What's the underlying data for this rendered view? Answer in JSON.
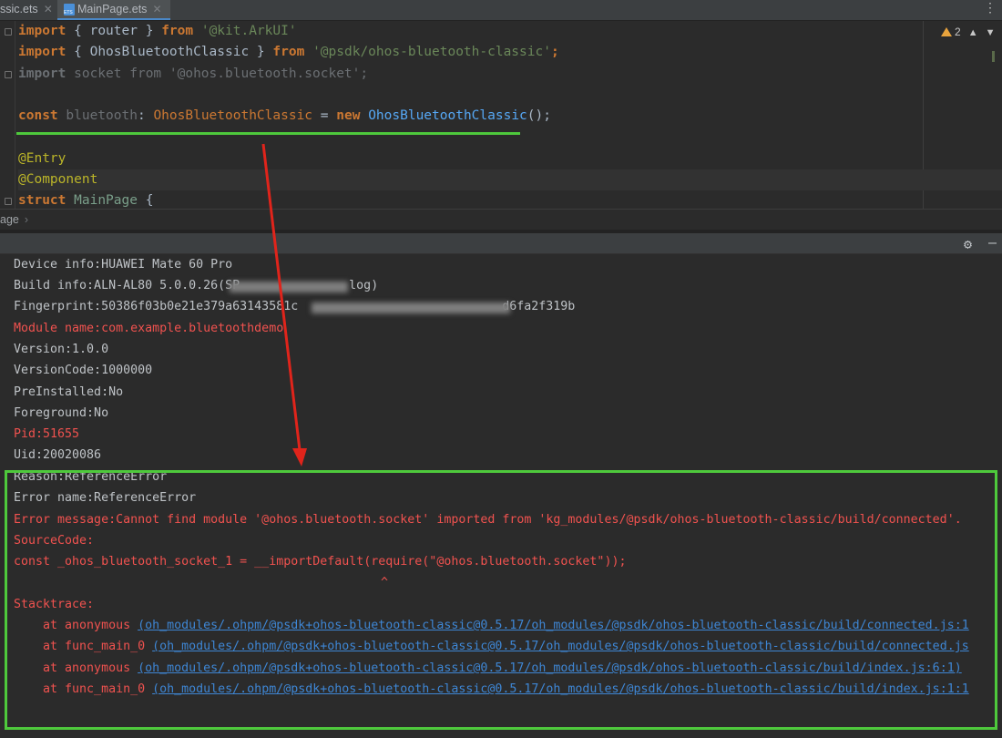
{
  "tabs": [
    {
      "label": "ssic.ets",
      "close": "✕"
    },
    {
      "label": "MainPage.ets",
      "close": "✕"
    }
  ],
  "tab_menu": "⋮",
  "editor": {
    "warning_count": "2",
    "lines": {
      "l1": {
        "kw1": "import",
        "p1": " { ",
        "id": "router",
        "p2": " } ",
        "kw2": "from",
        "sp": " ",
        "str": "'@kit.ArkUI'"
      },
      "l2": {
        "kw1": "import",
        "p1": " { ",
        "id": "OhosBluetoothClassic",
        "p2": " } ",
        "kw2": "from",
        "sp": " ",
        "str": "'@psdk/ohos-bluetooth-classic'",
        "end": ";"
      },
      "l3": {
        "kw1": "import",
        "rest": " socket from '@ohos.bluetooth.socket';"
      },
      "l5": {
        "kw": "const",
        "sp": " ",
        "var": "bluetooth",
        "colon": ": ",
        "type": "OhosBluetoothClassic",
        "eq": " = ",
        "new": "new",
        "sp2": " ",
        "fn": "OhosBluetoothClassic",
        "end": "();"
      },
      "l7": "@Entry",
      "l8": "@Component",
      "l9": {
        "kw": "struct",
        "sp": " ",
        "name": "MainPage",
        "brace": " {"
      }
    }
  },
  "breadcrumb": {
    "label": "age",
    "chevron": "›"
  },
  "panel": {
    "gear": "⚙",
    "minimize": "—"
  },
  "log": {
    "device_info": "Device info:HUAWEI Mate 60 Pro",
    "build_info_a": "Build info:ALN-AL80 5.0.0.26(SP",
    "build_info_b": "log)",
    "fingerprint_a": "Fingerprint:50386f03b0e21e379a63143",
    "fingerprint_b": "581c",
    "fingerprint_c": "d6fa2f319b",
    "module_name": "Module name:com.example.bluetoothdemo",
    "version": "Version:1.0.0",
    "version_code": "VersionCode:1000000",
    "preinstalled": "PreInstalled:No",
    "foreground": "Foreground:No",
    "pid": "Pid:51655",
    "uid": "Uid:20020086",
    "reason": "Reason:ReferenceError",
    "error_name": "Error name:ReferenceError",
    "error_message": "Error message:Cannot find module '@ohos.bluetooth.socket' imported from 'kg_modules/@psdk/ohos-bluetooth-classic/build/connected'.",
    "source_code_label": "SourceCode:",
    "source_line": "const _ohos_bluetooth_socket_1 = __importDefault(require(\"@ohos.bluetooth.socket\"));",
    "caret": "^",
    "stacktrace_label": "Stacktrace:",
    "stack": [
      {
        "prefix": "    at anonymous ",
        "link": "(oh_modules/.ohpm/@psdk+ohos-bluetooth-classic@0.5.17/oh_modules/@psdk/ohos-bluetooth-classic/build/connected.js:1"
      },
      {
        "prefix": "    at func_main_0 ",
        "link": "(oh_modules/.ohpm/@psdk+ohos-bluetooth-classic@0.5.17/oh_modules/@psdk/ohos-bluetooth-classic/build/connected.js"
      },
      {
        "prefix": "    at anonymous ",
        "link": "(oh_modules/.ohpm/@psdk+ohos-bluetooth-classic@0.5.17/oh_modules/@psdk/ohos-bluetooth-classic/build/index.js:6:1)"
      },
      {
        "prefix": "    at func_main_0 ",
        "link": "(oh_modules/.ohpm/@psdk+ohos-bluetooth-classic@0.5.17/oh_modules/@psdk/ohos-bluetooth-classic/build/index.js:1:1"
      }
    ]
  },
  "colors": {
    "annotation_green": "#4ec93c",
    "arrow_red": "#e0241b",
    "error_red": "#f0524f",
    "link_blue": "#3e86d4"
  }
}
